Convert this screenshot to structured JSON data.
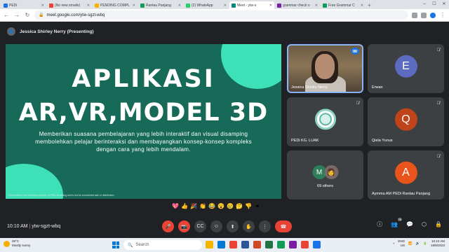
{
  "browser": {
    "tabs": [
      {
        "label": "PEDi",
        "color": "#1a73e8"
      },
      {
        "label": "(No new emails)",
        "color": "#ea4335"
      },
      {
        "label": "PENDING COMPL",
        "color": "#f4b400"
      },
      {
        "label": "Rantau Panjang",
        "color": "#0f9d58"
      },
      {
        "label": "(2) WhatsApp",
        "color": "#25d366"
      },
      {
        "label": "Meet - ytw-s",
        "color": "#00897b",
        "active": true
      },
      {
        "label": "grammar check o",
        "color": "#7b1fa2"
      },
      {
        "label": "Free Grammar C",
        "color": "#0f9d58"
      }
    ],
    "new_tab": "+",
    "url": "meet.google.com/ytw-sgzt-wbq"
  },
  "meet": {
    "presenter_label": "Jessica Shirley Nerry (Presenting)",
    "slide": {
      "title_line1": "APLIKASI",
      "title_line2": "AR,VR,MODEL 3D",
      "body": "Memberikan suasana pembelajaran yang lebih interaktif dan visual disamping memboleh­kan pelajar berinteraksi dan membayangkan konsep-konsep kompleks dengan cara yang lebih mendalam.",
      "footer": "This content is the exclusive property of PEDi. Browsing and is not for commercial sale or distribution."
    },
    "participants": [
      {
        "name": "Jessica Shirley Nerry",
        "type": "video"
      },
      {
        "name": "Erwan",
        "initial": "E",
        "color": "#5c6bc0"
      },
      {
        "name": "PEDi KG. LUAK",
        "type": "logo"
      },
      {
        "name": "Qiela Yunus",
        "initial": "Q",
        "color": "#c0441a"
      },
      {
        "name": "69 others",
        "type": "group",
        "initial": "M",
        "color": "#2e7d5b"
      },
      {
        "name": "Aymma AM PEDi Rantau Panjang",
        "initial": "A",
        "color": "#e8541c"
      }
    ],
    "reactions": [
      "💖",
      "👍",
      "🎉",
      "👏",
      "😂",
      "😮",
      "😢",
      "🤔",
      "👎",
      "⏺"
    ],
    "meeting_time": "10:10 AM",
    "meeting_code": "ytw-sgzt-wbq",
    "participant_count": "79"
  },
  "taskbar": {
    "weather_temp": "28°C",
    "weather_desc": "Mostly sunny",
    "search_placeholder": "Search",
    "lang": "ENG",
    "region": "US",
    "time": "10:10 AM",
    "date": "18/8/2023"
  }
}
